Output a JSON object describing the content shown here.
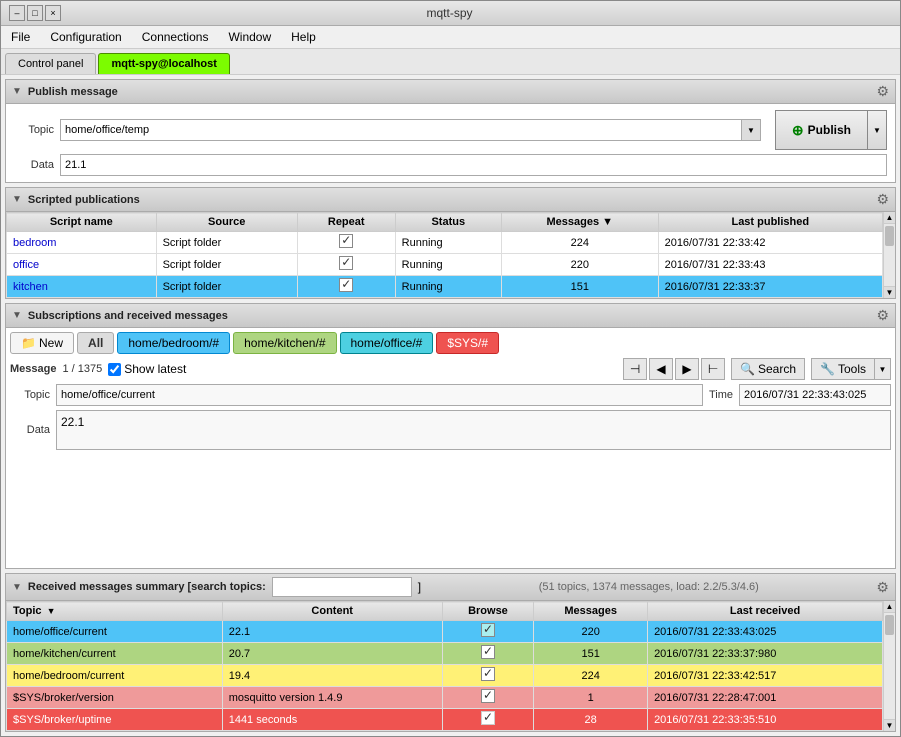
{
  "window": {
    "title": "mqtt-spy",
    "controls": [
      "–",
      "□",
      "×"
    ]
  },
  "menu": {
    "items": [
      "File",
      "Configuration",
      "Connections",
      "Window",
      "Help"
    ]
  },
  "tabs": {
    "control_panel": "Control panel",
    "connection": "mqtt-spy@localhost"
  },
  "publish": {
    "section_title": "Publish message",
    "topic_label": "Topic",
    "topic_value": "home/office/temp",
    "data_label": "Data",
    "data_value": "21.1",
    "publish_button": "Publish"
  },
  "scripted": {
    "section_title": "Scripted publications",
    "columns": [
      "Script name",
      "Source",
      "Repeat",
      "Status",
      "Messages",
      "Last published"
    ],
    "rows": [
      {
        "name": "bedroom",
        "source": "Script folder",
        "repeat": true,
        "status": "Running",
        "messages": "224",
        "last": "2016/07/31 22:33:42",
        "selected": false
      },
      {
        "name": "office",
        "source": "Script folder",
        "repeat": true,
        "status": "Running",
        "messages": "220",
        "last": "2016/07/31 22:33:43",
        "selected": false
      },
      {
        "name": "kitchen",
        "source": "Script folder",
        "repeat": true,
        "status": "Running",
        "messages": "151",
        "last": "2016/07/31 22:33:37",
        "selected": true
      }
    ]
  },
  "subscriptions": {
    "section_title": "Subscriptions and received messages",
    "tabs": [
      {
        "label": "New",
        "type": "new-tab"
      },
      {
        "label": "All",
        "type": "all-tab"
      },
      {
        "label": "home/bedroom/#",
        "type": "blue-tab"
      },
      {
        "label": "home/kitchen/#",
        "type": "green-tab"
      },
      {
        "label": "home/office/#",
        "type": "teal-tab"
      },
      {
        "label": "$SYS/#",
        "type": "red-tab"
      }
    ],
    "message_label": "Message",
    "message_count": "1 / 1375",
    "show_latest": "Show latest",
    "search_label": "Search",
    "tools_label": "Tools",
    "topic_label": "Topic",
    "topic_value": "home/office/current",
    "time_label": "Time",
    "time_value": "2016/07/31 22:33:43:025",
    "data_label": "Data",
    "data_value": "22.1"
  },
  "summary": {
    "section_title": "Received messages summary [search topics:",
    "search_placeholder": "",
    "section_close": "]",
    "info": "(51 topics, 1374 messages, load: 2.2/5.3/4.6)",
    "columns": [
      "Topic",
      "Content",
      "Browse",
      "Messages",
      "Last received"
    ],
    "rows": [
      {
        "topic": "home/office/current",
        "content": "22.1",
        "browse": true,
        "messages": "220",
        "last": "2016/07/31 22:33:43:025",
        "color": "cyan"
      },
      {
        "topic": "home/kitchen/current",
        "content": "20.7",
        "browse": true,
        "messages": "151",
        "last": "2016/07/31 22:33:37:980",
        "color": "green"
      },
      {
        "topic": "home/bedroom/current",
        "content": "19.4",
        "browse": true,
        "messages": "224",
        "last": "2016/07/31 22:33:42:517",
        "color": "yellow"
      },
      {
        "topic": "$SYS/broker/version",
        "content": "mosquitto version 1.4.9",
        "browse": true,
        "messages": "1",
        "last": "2016/07/31 22:28:47:001",
        "color": "red1"
      },
      {
        "topic": "$SYS/broker/uptime",
        "content": "1441 seconds",
        "browse": true,
        "messages": "28",
        "last": "2016/07/31 22:33:35:510",
        "color": "red2"
      }
    ]
  }
}
